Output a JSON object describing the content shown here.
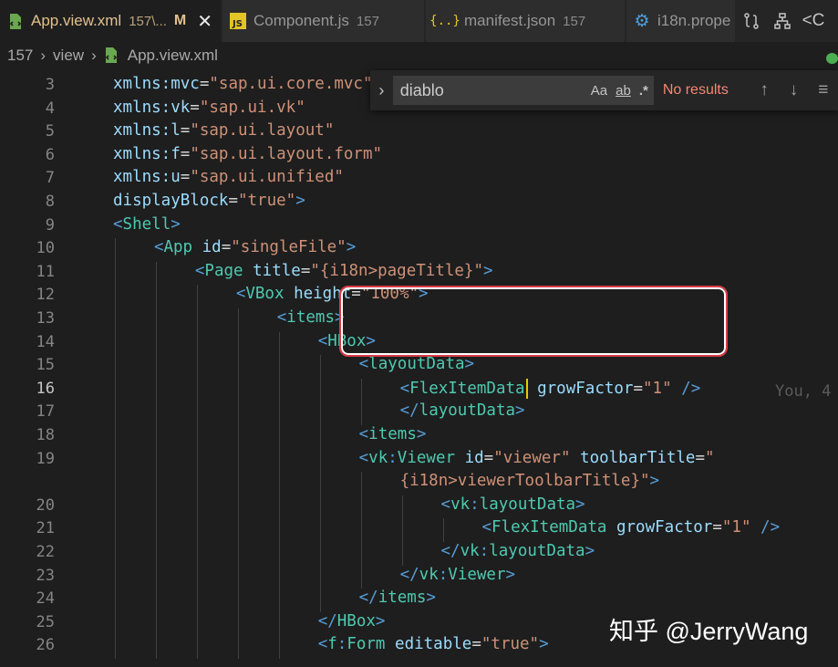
{
  "tabs": [
    {
      "name": "App.view.xml",
      "dir": "157\\...",
      "status": "M",
      "active": true,
      "icon": "xml-file-icon"
    },
    {
      "name": "Component.js",
      "dir": "157",
      "active": false,
      "icon": "js-file-icon"
    },
    {
      "name": "manifest.json",
      "dir": "157",
      "active": false,
      "icon": "json-file-icon"
    },
    {
      "name": "i18n.prope",
      "active": false,
      "icon": "gear-icon"
    }
  ],
  "toolbar": {
    "icons": [
      "compare-changes-icon",
      "source-control-graph-icon",
      "go-back-icon"
    ]
  },
  "breadcrumb": {
    "parts": [
      "157",
      "view",
      "App.view.xml"
    ]
  },
  "find": {
    "query": "diablo",
    "match_case": "Aa",
    "whole_word": "ab",
    "regex": ".*",
    "result": "No results",
    "prev": "↑",
    "next": "↓",
    "more": "≡"
  },
  "blame": "You, 4",
  "watermark": "知乎 @JerryWang",
  "colors": {
    "highlight_border": "#d63b46",
    "cursor": "#e8c900",
    "no_results": "#f48771"
  },
  "lines": [
    {
      "n": "3",
      "code": [
        [
          "attr",
          "xmlns:mvc"
        ],
        [
          "eq",
          "="
        ],
        [
          "str",
          "\"sap.ui.core.mvc\""
        ]
      ]
    },
    {
      "n": "4",
      "code": [
        [
          "attr",
          "xmlns:vk"
        ],
        [
          "eq",
          "="
        ],
        [
          "str",
          "\"sap.ui.vk\""
        ]
      ]
    },
    {
      "n": "5",
      "code": [
        [
          "attr",
          "xmlns:l"
        ],
        [
          "eq",
          "="
        ],
        [
          "str",
          "\"sap.ui.layout\""
        ]
      ]
    },
    {
      "n": "6",
      "code": [
        [
          "attr",
          "xmlns:f"
        ],
        [
          "eq",
          "="
        ],
        [
          "str",
          "\"sap.ui.layout.form\""
        ]
      ]
    },
    {
      "n": "7",
      "code": [
        [
          "attr",
          "xmlns:u"
        ],
        [
          "eq",
          "="
        ],
        [
          "str",
          "\"sap.ui.unified\""
        ]
      ]
    },
    {
      "n": "8",
      "code": [
        [
          "attr",
          "displayBlock"
        ],
        [
          "eq",
          "="
        ],
        [
          "str",
          "\"true\""
        ],
        [
          "t",
          ">"
        ]
      ]
    },
    {
      "n": "9",
      "code": [
        [
          "t",
          "<"
        ],
        [
          "vtag",
          "Shell"
        ],
        [
          "t",
          ">"
        ]
      ]
    },
    {
      "n": "10",
      "code": [
        [
          "t",
          "<"
        ],
        [
          "vtag",
          "App"
        ],
        [
          "txt",
          " "
        ],
        [
          "attr",
          "id"
        ],
        [
          "eq",
          "="
        ],
        [
          "str",
          "\"singleFile\""
        ],
        [
          "t",
          ">"
        ]
      ]
    },
    {
      "n": "11",
      "code": [
        [
          "t",
          "<"
        ],
        [
          "vtag",
          "Page"
        ],
        [
          "txt",
          " "
        ],
        [
          "attr",
          "title"
        ],
        [
          "eq",
          "="
        ],
        [
          "str",
          "\"{i18n>pageTitle}\""
        ],
        [
          "t",
          ">"
        ]
      ]
    },
    {
      "n": "12",
      "code": [
        [
          "t",
          "<"
        ],
        [
          "vtag",
          "VBox"
        ],
        [
          "txt",
          " "
        ],
        [
          "attr",
          "height"
        ],
        [
          "eq",
          "="
        ],
        [
          "str",
          "\"100%\""
        ],
        [
          "t",
          ">"
        ]
      ]
    },
    {
      "n": "13",
      "code": [
        [
          "t",
          "<"
        ],
        [
          "vtag",
          "items"
        ],
        [
          "t",
          ">"
        ]
      ]
    },
    {
      "n": "14",
      "code": [
        [
          "t",
          "<"
        ],
        [
          "vtag",
          "HBox"
        ],
        [
          "t",
          ">"
        ]
      ]
    },
    {
      "n": "15",
      "code": [
        [
          "t",
          "<"
        ],
        [
          "vtag",
          "layoutData"
        ],
        [
          "t",
          ">"
        ]
      ]
    },
    {
      "n": "16",
      "code": [
        [
          "t",
          "<"
        ],
        [
          "vtag",
          "FlexItemData"
        ],
        [
          "cursor",
          ""
        ],
        [
          "txt",
          " "
        ],
        [
          "attr",
          "growFactor"
        ],
        [
          "eq",
          "="
        ],
        [
          "str",
          "\"1\""
        ],
        [
          "txt",
          " "
        ],
        [
          "t",
          "/>"
        ]
      ]
    },
    {
      "n": "17",
      "code": [
        [
          "t",
          "</"
        ],
        [
          "vtag",
          "layoutData"
        ],
        [
          "t",
          ">"
        ]
      ]
    },
    {
      "n": "18",
      "code": [
        [
          "t",
          "<"
        ],
        [
          "vtag",
          "items"
        ],
        [
          "t",
          ">"
        ]
      ]
    },
    {
      "n": "19",
      "code": [
        [
          "t",
          "<"
        ],
        [
          "vtag",
          "vk"
        ],
        [
          "t",
          ":"
        ],
        [
          "vtag",
          "Viewer"
        ],
        [
          "txt",
          " "
        ],
        [
          "attr",
          "id"
        ],
        [
          "eq",
          "="
        ],
        [
          "str",
          "\"viewer\""
        ],
        [
          "txt",
          " "
        ],
        [
          "attr",
          "toolbarTitle"
        ],
        [
          "eq",
          "="
        ],
        [
          "str",
          "\""
        ]
      ]
    },
    {
      "n": "",
      "code": [
        [
          "str",
          "{i18n>viewerToolbarTitle}\""
        ],
        [
          "t",
          ">"
        ]
      ]
    },
    {
      "n": "20",
      "code": [
        [
          "t",
          "<"
        ],
        [
          "vtag",
          "vk"
        ],
        [
          "t",
          ":"
        ],
        [
          "vtag",
          "layoutData"
        ],
        [
          "t",
          ">"
        ]
      ]
    },
    {
      "n": "21",
      "code": [
        [
          "t",
          "<"
        ],
        [
          "vtag",
          "FlexItemData"
        ],
        [
          "txt",
          " "
        ],
        [
          "attr",
          "growFactor"
        ],
        [
          "eq",
          "="
        ],
        [
          "str",
          "\"1\""
        ],
        [
          "txt",
          " "
        ],
        [
          "t",
          "/>"
        ]
      ]
    },
    {
      "n": "22",
      "code": [
        [
          "t",
          "</"
        ],
        [
          "vtag",
          "vk"
        ],
        [
          "t",
          ":"
        ],
        [
          "vtag",
          "layoutData"
        ],
        [
          "t",
          ">"
        ]
      ]
    },
    {
      "n": "23",
      "code": [
        [
          "t",
          "</"
        ],
        [
          "vtag",
          "vk"
        ],
        [
          "t",
          ":"
        ],
        [
          "vtag",
          "Viewer"
        ],
        [
          "t",
          ">"
        ]
      ]
    },
    {
      "n": "24",
      "code": [
        [
          "t",
          "</"
        ],
        [
          "vtag",
          "items"
        ],
        [
          "t",
          ">"
        ]
      ]
    },
    {
      "n": "25",
      "code": [
        [
          "t",
          "</"
        ],
        [
          "vtag",
          "HBox"
        ],
        [
          "t",
          ">"
        ]
      ]
    },
    {
      "n": "26",
      "code": [
        [
          "t",
          "<"
        ],
        [
          "vtag",
          "f"
        ],
        [
          "t",
          ":"
        ],
        [
          "vtag",
          "Form"
        ],
        [
          "txt",
          " "
        ],
        [
          "attr",
          "editable"
        ],
        [
          "eq",
          "="
        ],
        [
          "str",
          "\"true\""
        ],
        [
          "t",
          ">"
        ]
      ]
    }
  ]
}
